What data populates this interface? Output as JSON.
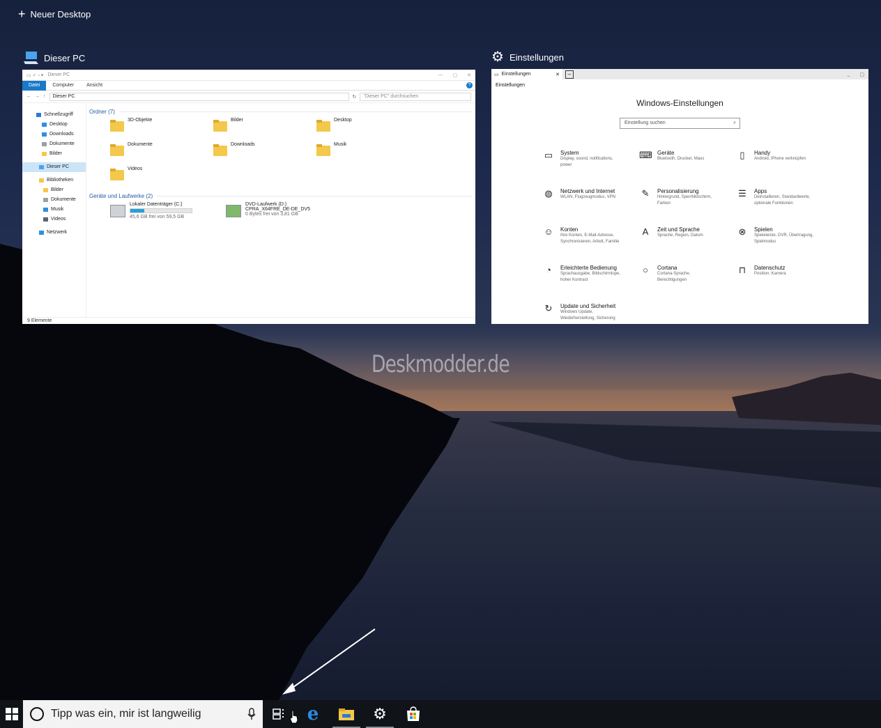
{
  "new_desktop": {
    "label": "Neuer Desktop"
  },
  "explorer_window": {
    "title": "Dieser PC",
    "titlebar_text": "Dieser PC",
    "ribbon": [
      "Datei",
      "Computer",
      "Ansicht"
    ],
    "address": "Dieser PC",
    "search_placeholder": "\"Dieser PC\" durchsuchen",
    "nav": [
      "Schnellzugriff",
      "Desktop",
      "Downloads",
      "Dokumente",
      "Bilder",
      "Dieser PC",
      "Bibliotheken",
      "Bilder",
      "Dokumente",
      "Musik",
      "Videos",
      "Netzwerk"
    ],
    "folders_header": "Ordner (7)",
    "folders": [
      "3D-Objekte",
      "Bilder",
      "Desktop",
      "Dokumente",
      "Downloads",
      "Musik",
      "Videos"
    ],
    "drives_header": "Geräte und Laufwerke (2)",
    "drives": [
      {
        "name": "Lokaler Datenträger (C:)",
        "sub": "",
        "free": "45,6 GB frei von 59,5 GB",
        "used_fraction": 0.23
      },
      {
        "name": "DVD-Laufwerk (D:)",
        "sub": "CPRA_X64FRE_DE-DE_DV5",
        "free": "0 Bytes frei von 3,81 GB",
        "used_fraction": 1.0
      }
    ],
    "status": "9 Elemente"
  },
  "settings_window": {
    "title": "Einstellungen",
    "tab_label": "Einstellungen",
    "crumb": "Einstellungen",
    "heading": "Windows-Einstellungen",
    "search_placeholder": "Einstellung suchen",
    "items": [
      {
        "icon": "laptop-icon",
        "title": "System",
        "sub": "Display, sound, notifications, power"
      },
      {
        "icon": "devices-icon",
        "title": "Geräte",
        "sub": "Bluetooth, Drucker, Maus"
      },
      {
        "icon": "phone-icon",
        "title": "Handy",
        "sub": "Android, iPhone verknüpfen"
      },
      {
        "icon": "globe-icon",
        "title": "Netzwerk und Internet",
        "sub": "WLAN, Flugzeugmodus, VPN"
      },
      {
        "icon": "paint-icon",
        "title": "Personalisierung",
        "sub": "Hintergrund, Sperrbildschirm, Farben"
      },
      {
        "icon": "apps-icon",
        "title": "Apps",
        "sub": "Deinstallieren, Standardwerte, optionale Funktionen"
      },
      {
        "icon": "person-icon",
        "title": "Konten",
        "sub": "Ihre Konten, E-Mail-Adresse, Synchronisieren, Arbeit, Familie"
      },
      {
        "icon": "language-icon",
        "title": "Zeit und Sprache",
        "sub": "Sprache, Region, Datum"
      },
      {
        "icon": "xbox-icon",
        "title": "Spielen",
        "sub": "Spieleleiste, DVR, Übertragung, Spielmodus"
      },
      {
        "icon": "accessibility-icon",
        "title": "Erleichterte Bedienung",
        "sub": "Sprachausgabe, Bildschirmlupe, hoher Kontrast"
      },
      {
        "icon": "cortana-icon",
        "title": "Cortana",
        "sub": "Cortana-Sprache, Berechtigungen"
      },
      {
        "icon": "lock-icon",
        "title": "Datenschutz",
        "sub": "Position, Kamera"
      },
      {
        "icon": "update-icon",
        "title": "Update und Sicherheit",
        "sub": "Windows Update, Wiederherstellung, Sicherung"
      }
    ]
  },
  "watermark": "Deskmodder.de",
  "taskbar": {
    "search_placeholder": "Tipp was ein, mir ist langweilig",
    "apps": [
      "task-view-icon",
      "edge-icon",
      "file-explorer-icon",
      "settings-icon",
      "store-icon"
    ]
  },
  "colors": {
    "accent": "#1979ca",
    "taskbar": "#101418",
    "folder": "#f3c84b"
  }
}
